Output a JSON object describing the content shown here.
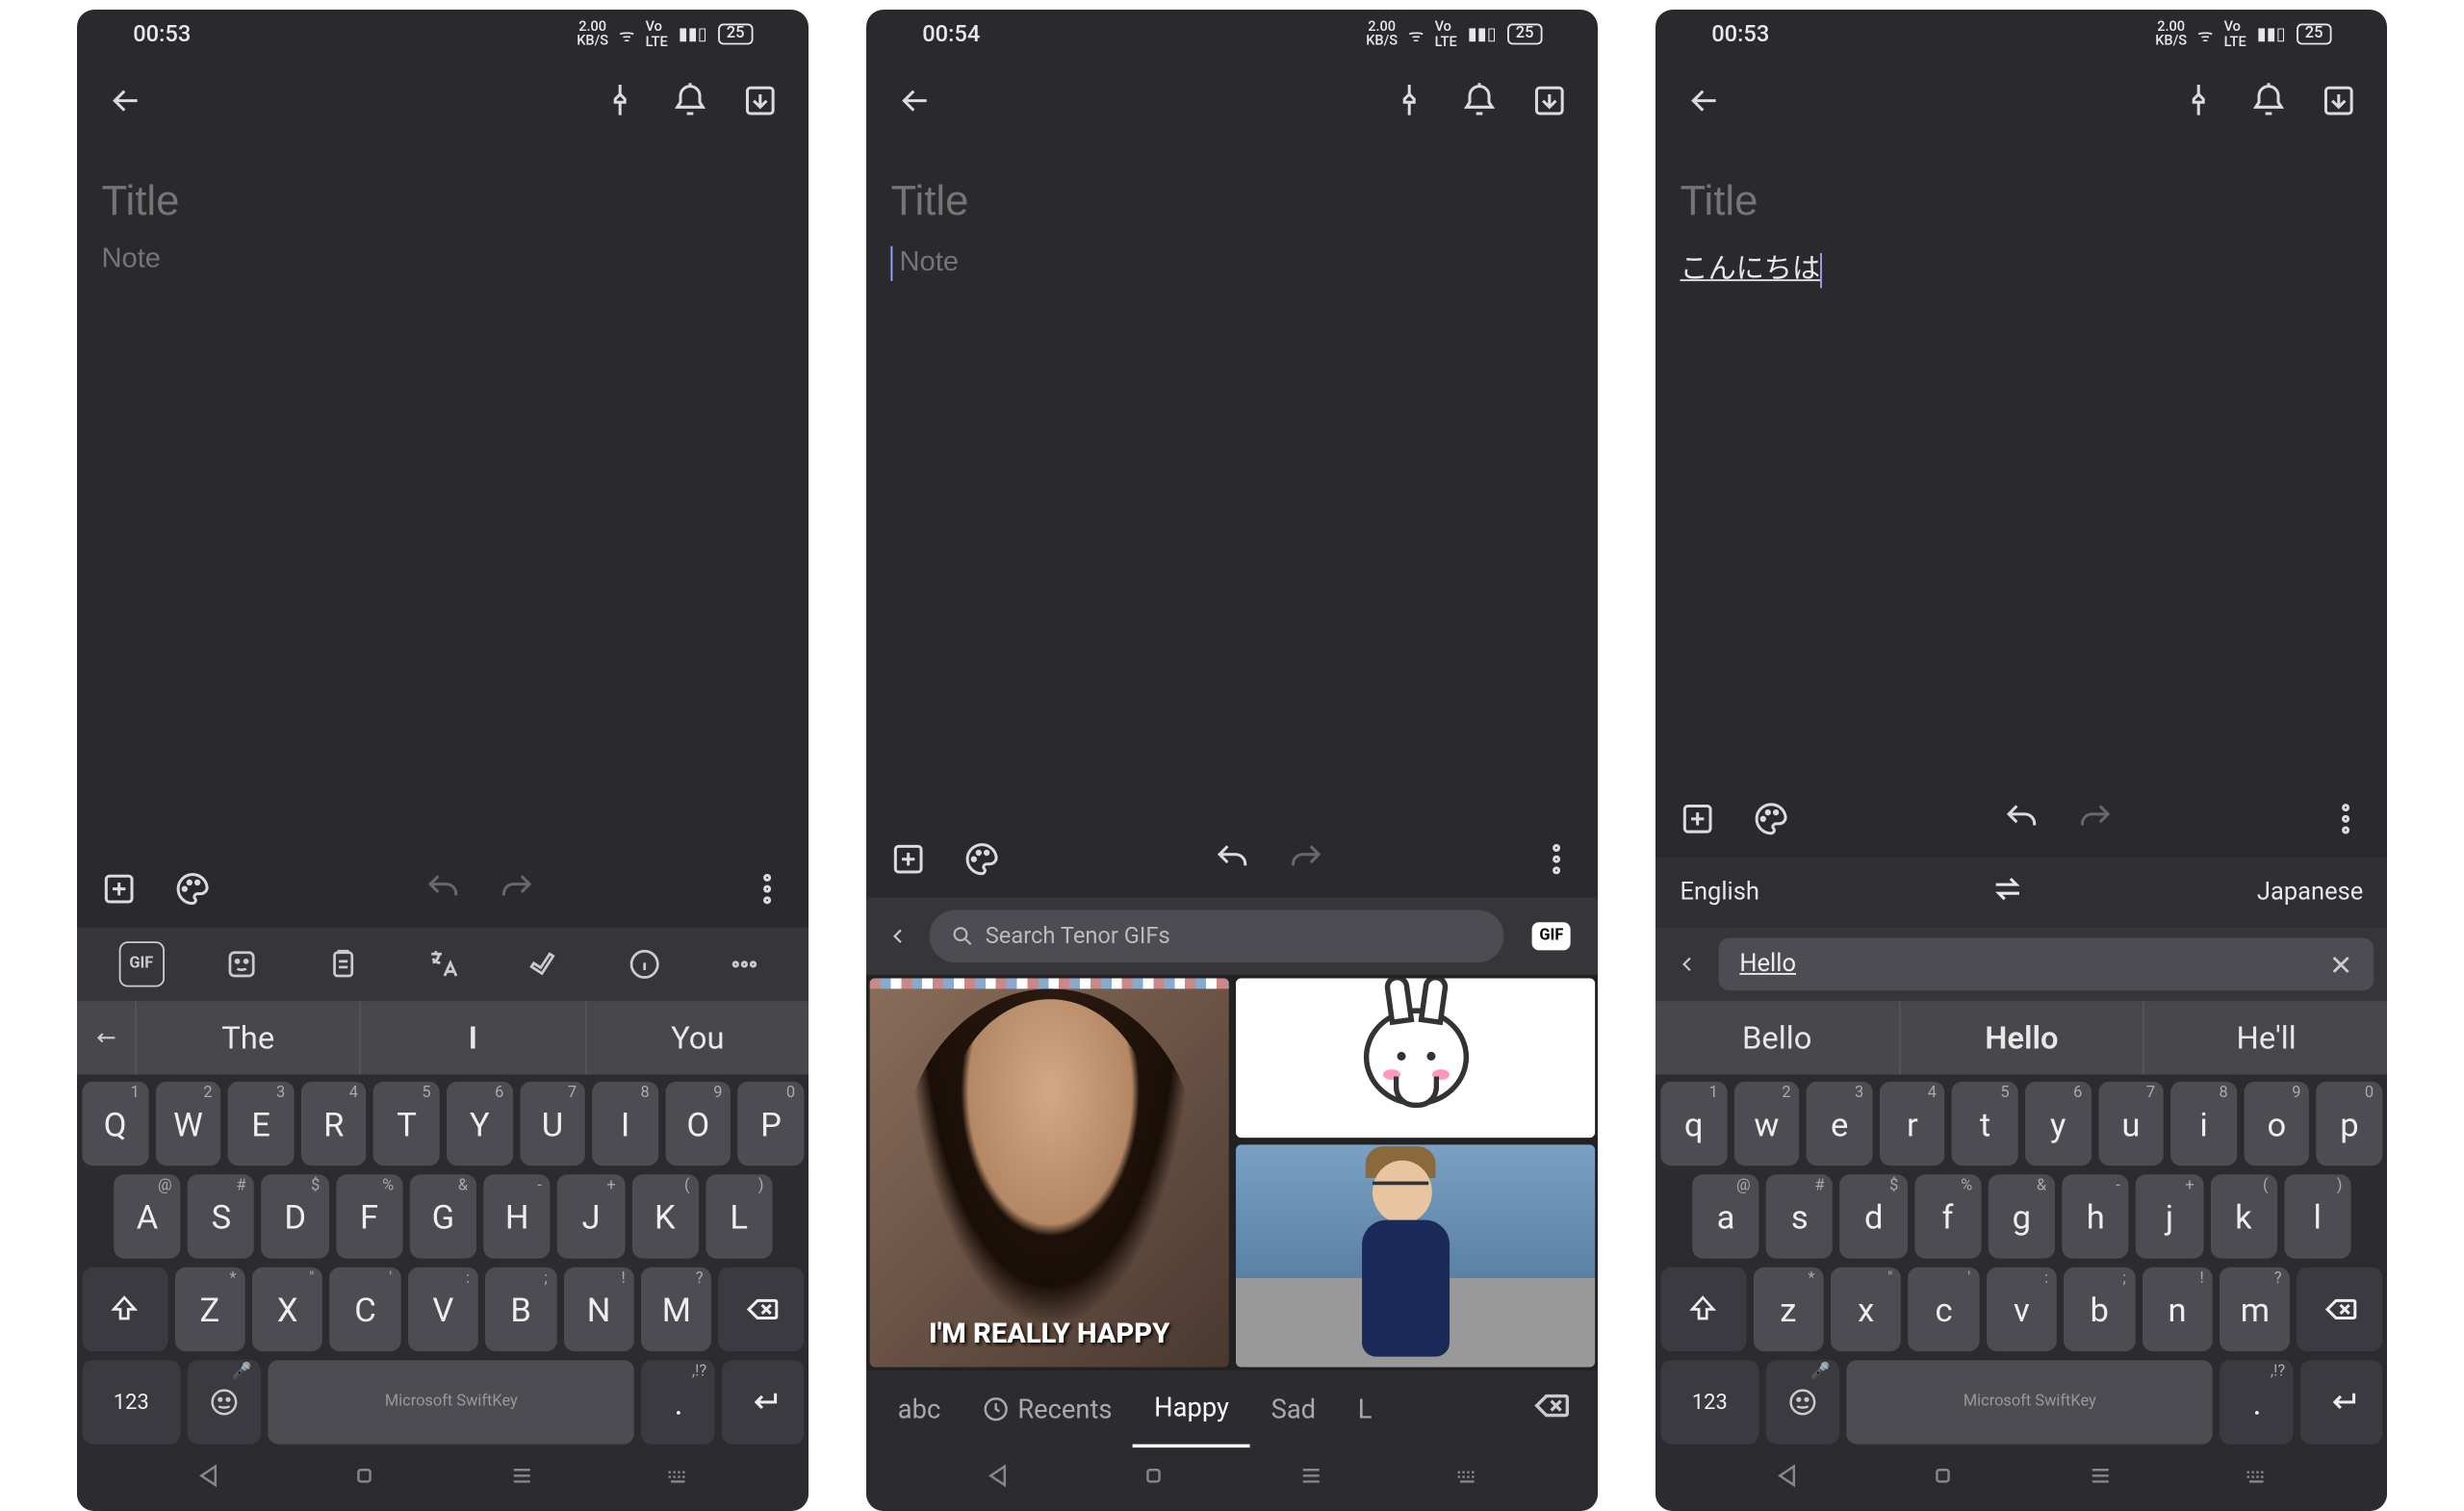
{
  "screens": [
    {
      "statusbar": {
        "time": "00:53",
        "kbs": "2.00",
        "kbs_label": "KB/S",
        "battery": "25"
      },
      "title_placeholder": "Title",
      "note_placeholder": "Note",
      "suggestions": {
        "s1": "The",
        "s2": "I",
        "s3": "You"
      },
      "keyboard_branding": "Microsoft SwiftKey",
      "keys_row1": [
        "Q",
        "W",
        "E",
        "R",
        "T",
        "Y",
        "U",
        "I",
        "O",
        "P"
      ],
      "keys_row1_sec": [
        "1",
        "2",
        "3",
        "4",
        "5",
        "6",
        "7",
        "8",
        "9",
        "0"
      ],
      "keys_row2": [
        "A",
        "S",
        "D",
        "F",
        "G",
        "H",
        "J",
        "K",
        "L"
      ],
      "keys_row2_sec": [
        "@",
        "#",
        "$",
        "%",
        "&",
        "-",
        "+",
        "(",
        ")"
      ],
      "keys_row3": [
        "Z",
        "X",
        "C",
        "V",
        "B",
        "N",
        "M"
      ],
      "keys_row3_sec": [
        "*",
        "\"",
        "'",
        ":",
        ";",
        "!",
        "?"
      ],
      "nums_label": "123",
      "period_label": "."
    },
    {
      "statusbar": {
        "time": "00:54",
        "kbs": "2.00",
        "kbs_label": "KB/S",
        "battery": "25"
      },
      "title_placeholder": "Title",
      "note_placeholder": "Note",
      "gif": {
        "search_placeholder": "Search Tenor GIFs",
        "badge": "GIF",
        "caption": "I'M REALLY HAPPY",
        "categories": {
          "abc": "abc",
          "recents": "Recents",
          "happy": "Happy",
          "sad": "Sad",
          "next": "L"
        }
      }
    },
    {
      "statusbar": {
        "time": "00:53",
        "kbs": "2.00",
        "kbs_label": "KB/S",
        "battery": "25"
      },
      "title_placeholder": "Title",
      "note_text": "こんにちは",
      "translator": {
        "source": "English",
        "target": "Japanese",
        "input": "Hello"
      },
      "suggestions": {
        "s1": "Bello",
        "s2": "Hello",
        "s3": "He'll"
      },
      "keyboard_branding": "Microsoft SwiftKey",
      "keys_row1": [
        "q",
        "w",
        "e",
        "r",
        "t",
        "y",
        "u",
        "i",
        "o",
        "p"
      ],
      "keys_row1_sec": [
        "1",
        "2",
        "3",
        "4",
        "5",
        "6",
        "7",
        "8",
        "9",
        "0"
      ],
      "keys_row2": [
        "a",
        "s",
        "d",
        "f",
        "g",
        "h",
        "j",
        "k",
        "l"
      ],
      "keys_row2_sec": [
        "@",
        "#",
        "$",
        "%",
        "&",
        "-",
        "+",
        "(",
        ")"
      ],
      "keys_row3": [
        "z",
        "x",
        "c",
        "v",
        "b",
        "n",
        "m"
      ],
      "keys_row3_sec": [
        "*",
        "\"",
        "'",
        ":",
        ";",
        "!",
        "?"
      ],
      "nums_label": "123",
      "period_label": "."
    }
  ]
}
